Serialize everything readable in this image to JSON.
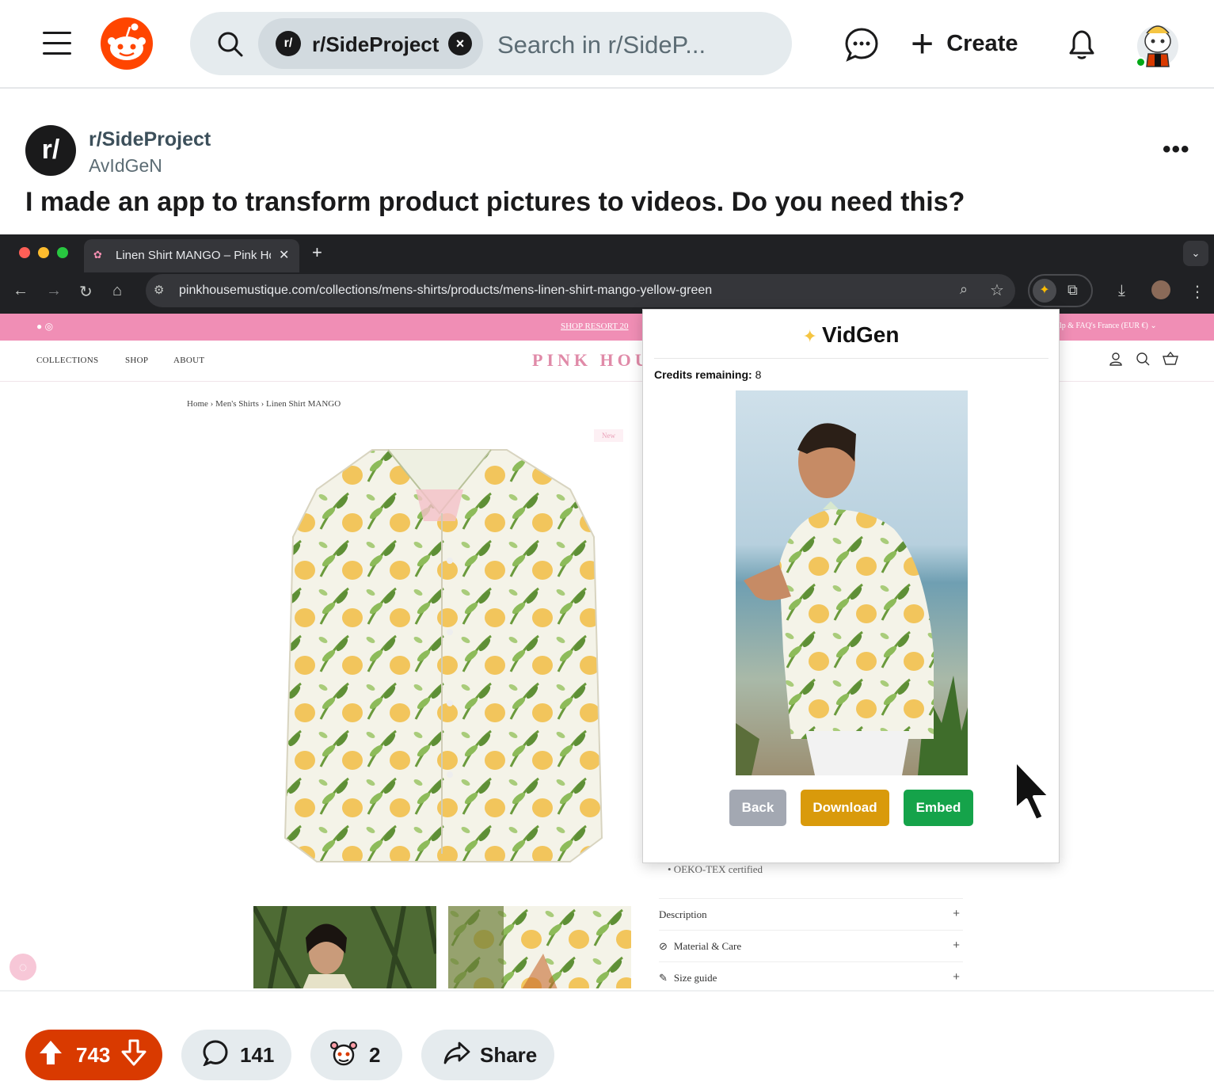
{
  "header": {
    "search_chip_prefix": "r/",
    "search_chip_label": "r/SideProject",
    "search_placeholder": "Search in r/SideP...",
    "create_label": "Create"
  },
  "post": {
    "subreddit_avatar": "r/",
    "subreddit": "r/SideProject",
    "author": "AvIdGeN",
    "title": "I made an app to transform product pictures to videos. Do you need this?"
  },
  "browser": {
    "tab_title": "Linen Shirt MANGO – Pink Ho",
    "url": "pinkhousemustique.com/collections/mens-shirts/products/mens-linen-shirt-mango-yellow-green"
  },
  "site": {
    "promo_text": "SHOP RESORT 20",
    "promo_right": "lp & FAQ's   France (EUR €) ⌄",
    "nav": [
      "COLLECTIONS",
      "SHOP",
      "ABOUT"
    ],
    "logo": "PINK HOU",
    "breadcrumb": "Home  ›  Men's Shirts  ›  Linen Shirt MANGO",
    "badge": "New",
    "oeko": "•  OEKO-TEX certified",
    "accordion": [
      {
        "label": "Description",
        "icon": "",
        "plus": "+"
      },
      {
        "label": "Material & Care",
        "icon": "leaf-icon",
        "plus": "+"
      },
      {
        "label": "Size guide",
        "icon": "pencil-icon",
        "plus": "+"
      }
    ]
  },
  "popup": {
    "title": "VidGen",
    "credits_label": "Credits remaining:",
    "credits_value": "8",
    "back_label": "Back",
    "download_label": "Download",
    "embed_label": "Embed",
    "colors": {
      "back": "#a3a8b2",
      "download": "#d99a0b",
      "embed": "#15a34a"
    }
  },
  "actions": {
    "votes": "743",
    "comments": "141",
    "awards": "2",
    "share_label": "Share"
  },
  "colors": {
    "reddit_orange": "#ff4500",
    "vote_bg": "#d93a00",
    "promo_pink": "#f08eb5"
  }
}
